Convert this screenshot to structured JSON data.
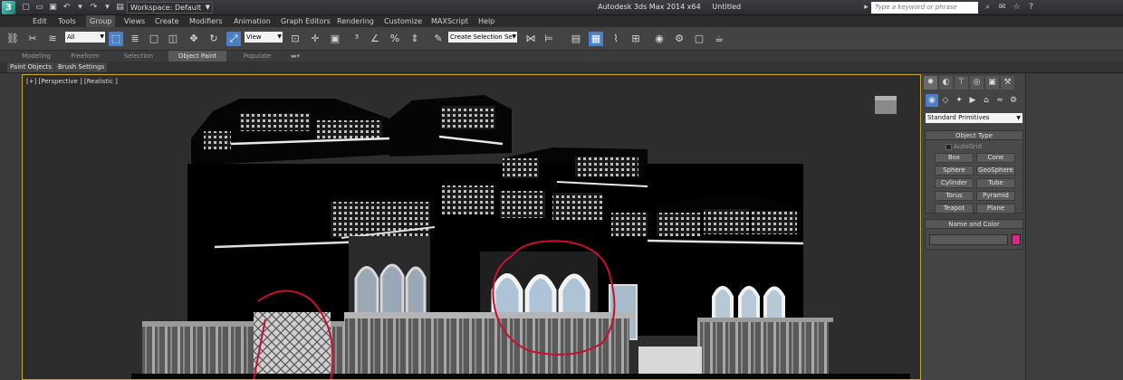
{
  "titlebar": {
    "workspace": "Workspace: Default",
    "window_title": "Autodesk 3ds Max 2014 x64",
    "doc_title": "Untitled",
    "search_placeholder": "Type a keyword or phrase"
  },
  "menu": {
    "items": [
      "Edit",
      "Tools",
      "Group",
      "Views",
      "Create",
      "Modifiers",
      "Animation",
      "Graph Editors",
      "Rendering",
      "Customize",
      "MAXScript",
      "Help"
    ],
    "active_index": 2
  },
  "toolbar": {
    "filter_value": "All",
    "reference_coord": "View",
    "named_selection_placeholder": "Create Selection Se"
  },
  "ribbon": {
    "tabs": [
      "Modeling",
      "Freeform",
      "Selection",
      "Object Paint",
      "Populate"
    ],
    "active_index": 3,
    "sub_tabs": [
      "Paint Objects",
      "Brush Settings"
    ]
  },
  "viewport": {
    "label": "[+] [Perspective ] [Realistic ]"
  },
  "command_panel": {
    "category": "Standard Primitives",
    "object_type": {
      "title": "Object Type",
      "autogrid": "AutoGrid",
      "buttons": [
        "Box",
        "Cone",
        "Sphere",
        "GeoSphere",
        "Cylinder",
        "Tube",
        "Torus",
        "Pyramid",
        "Teapot",
        "Plane"
      ]
    },
    "name_color": {
      "title": "Name and Color",
      "color": "#d22d86"
    }
  }
}
